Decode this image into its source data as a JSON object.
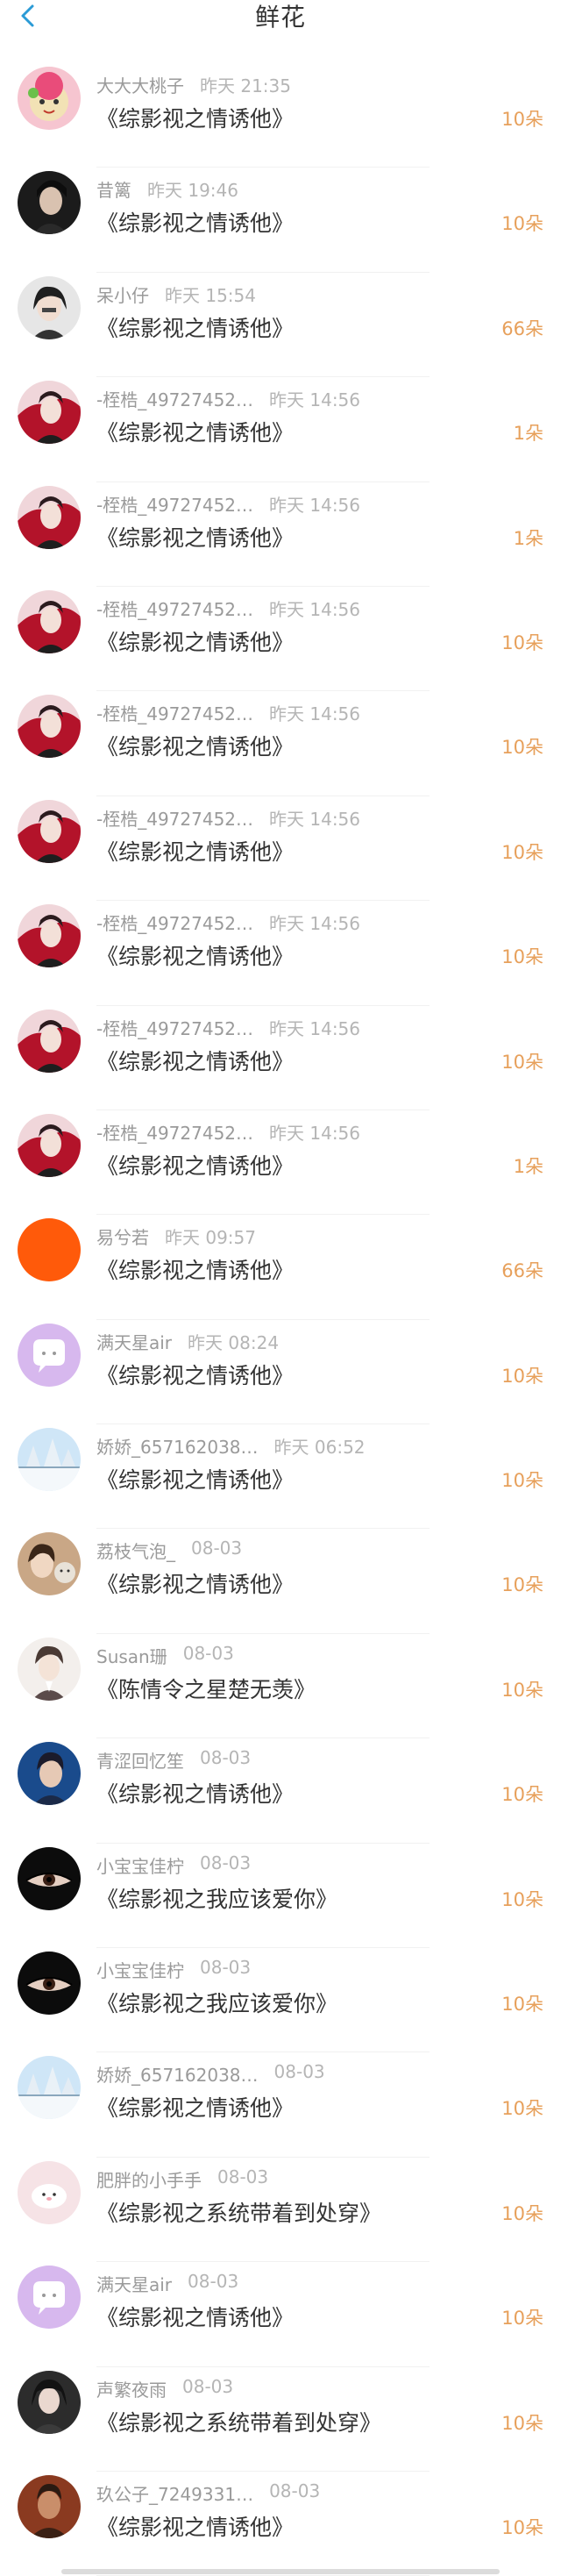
{
  "header": {
    "title": "鲜花"
  },
  "rows": [
    {
      "name": "大大大桃子",
      "time": "昨天 21:35",
      "book": "《综影视之情诱他》",
      "count": "10朵",
      "avatar": "peach-cartoon"
    },
    {
      "name": "昔篱",
      "time": "昨天 19:46",
      "book": "《综影视之情诱他》",
      "count": "10朵",
      "avatar": "dark-portrait"
    },
    {
      "name": "呆小仔",
      "time": "昨天 15:54",
      "book": "《综影视之情诱他》",
      "count": "66朵",
      "avatar": "girl-portrait"
    },
    {
      "name": "-桎梏_49727452…",
      "time": "昨天 14:56",
      "book": "《综影视之情诱他》",
      "count": "1朵",
      "avatar": "red-anime"
    },
    {
      "name": "-桎梏_49727452…",
      "time": "昨天 14:56",
      "book": "《综影视之情诱他》",
      "count": "1朵",
      "avatar": "red-anime"
    },
    {
      "name": "-桎梏_49727452…",
      "time": "昨天 14:56",
      "book": "《综影视之情诱他》",
      "count": "10朵",
      "avatar": "red-anime"
    },
    {
      "name": "-桎梏_49727452…",
      "time": "昨天 14:56",
      "book": "《综影视之情诱他》",
      "count": "10朵",
      "avatar": "red-anime"
    },
    {
      "name": "-桎梏_49727452…",
      "time": "昨天 14:56",
      "book": "《综影视之情诱他》",
      "count": "10朵",
      "avatar": "red-anime"
    },
    {
      "name": "-桎梏_49727452…",
      "time": "昨天 14:56",
      "book": "《综影视之情诱他》",
      "count": "10朵",
      "avatar": "red-anime"
    },
    {
      "name": "-桎梏_49727452…",
      "time": "昨天 14:56",
      "book": "《综影视之情诱他》",
      "count": "10朵",
      "avatar": "red-anime"
    },
    {
      "name": "-桎梏_49727452…",
      "time": "昨天 14:56",
      "book": "《综影视之情诱他》",
      "count": "1朵",
      "avatar": "red-anime"
    },
    {
      "name": "易兮若",
      "time": "昨天 09:57",
      "book": "《综影视之情诱他》",
      "count": "66朵",
      "avatar": "orange-circle"
    },
    {
      "name": "满天星air",
      "time": "昨天 08:24",
      "book": "《综影视之情诱他》",
      "count": "10朵",
      "avatar": "purple-chat"
    },
    {
      "name": "娇娇_657162038…",
      "time": "昨天 06:52",
      "book": "《综影视之情诱他》",
      "count": "10朵",
      "avatar": "winter-trees"
    },
    {
      "name": "荔枝气泡_",
      "time": "08-03",
      "book": "《综影视之情诱他》",
      "count": "10朵",
      "avatar": "cat-girl"
    },
    {
      "name": "Susan珊",
      "time": "08-03",
      "book": "《陈情令之星楚无羡》",
      "count": "10朵",
      "avatar": "anime-boy"
    },
    {
      "name": "青涩回忆笙",
      "time": "08-03",
      "book": "《综影视之情诱他》",
      "count": "10朵",
      "avatar": "blue-portrait"
    },
    {
      "name": "小宝宝佳柠",
      "time": "08-03",
      "book": "《综影视之我应该爱你》",
      "count": "10朵",
      "avatar": "eye-closeup"
    },
    {
      "name": "小宝宝佳柠",
      "time": "08-03",
      "book": "《综影视之我应该爱你》",
      "count": "10朵",
      "avatar": "eye-closeup"
    },
    {
      "name": "娇娇_657162038…",
      "time": "08-03",
      "book": "《综影视之情诱他》",
      "count": "10朵",
      "avatar": "winter-trees"
    },
    {
      "name": "肥胖的小手手",
      "time": "08-03",
      "book": "《综影视之系统带着到处穿》",
      "count": "10朵",
      "avatar": "pink-seal"
    },
    {
      "name": "满天星air",
      "time": "08-03",
      "book": "《综影视之情诱他》",
      "count": "10朵",
      "avatar": "purple-chat"
    },
    {
      "name": "声繁夜雨",
      "time": "08-03",
      "book": "《综影视之系统带着到处穿》",
      "count": "10朵",
      "avatar": "dark-girl"
    },
    {
      "name": "玖公子_7249331…",
      "time": "08-03",
      "book": "《综影视之情诱他》",
      "count": "10朵",
      "avatar": "man-portrait"
    }
  ],
  "colors": {
    "accent": "#2b9bd6",
    "count": "#e7a05b",
    "meta": "#9a9a9a"
  },
  "icons": {
    "back": "chevron-left-icon"
  }
}
